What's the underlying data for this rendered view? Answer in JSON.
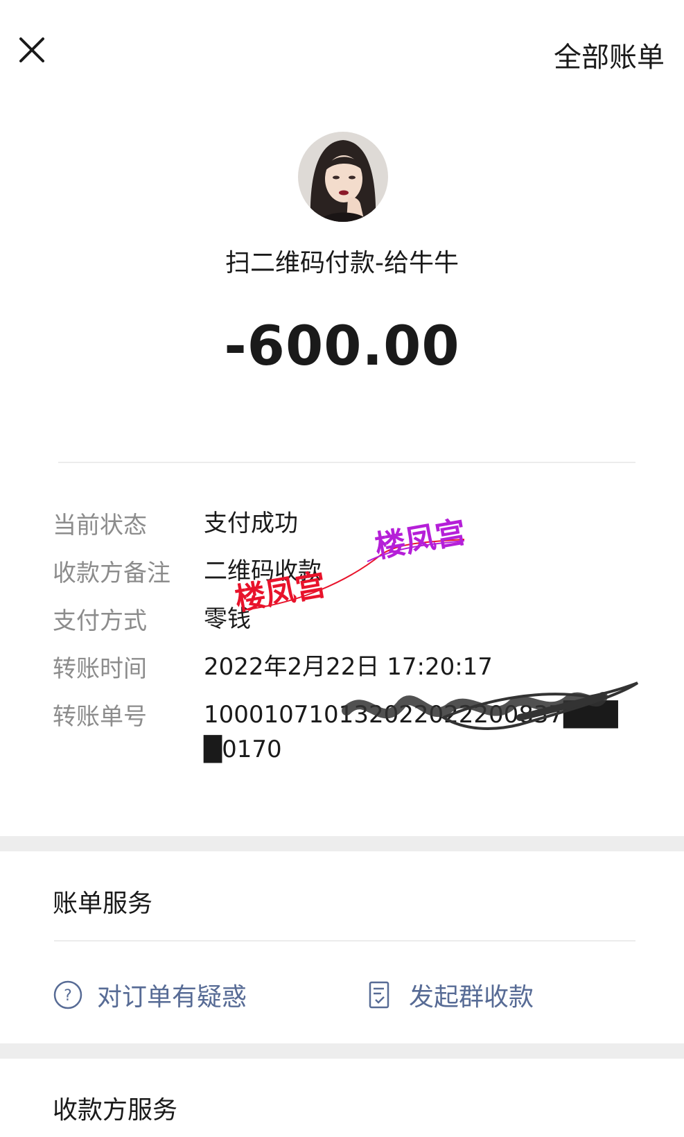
{
  "header": {
    "all_bills": "全部账单"
  },
  "payment": {
    "merchant": "扫二维码付款-给牛牛",
    "amount": "-600.00"
  },
  "details": [
    {
      "label": "当前状态",
      "value": "支付成功"
    },
    {
      "label": "收款方备注",
      "value": "二维码收款"
    },
    {
      "label": "支付方式",
      "value": "零钱"
    },
    {
      "label": "转账时间",
      "value": "2022年2月22日 17:20:17"
    },
    {
      "label": "转账单号",
      "value": "100010710132022022200837████0170"
    }
  ],
  "bill_service": {
    "title": "账单服务",
    "question_label": "对订单有疑惑",
    "group_collect_label": "发起群收款"
  },
  "payee_service": {
    "title": "收款方服务"
  },
  "watermark": {
    "text": "楼凤宫"
  },
  "colors": {
    "link": "#576b95",
    "label": "#8c8c8c",
    "watermark_red": "#e8132b",
    "watermark_purple": "#b51fd8"
  },
  "icons": [
    "close-icon",
    "avatar",
    "question-circle-icon",
    "group-collect-icon"
  ]
}
